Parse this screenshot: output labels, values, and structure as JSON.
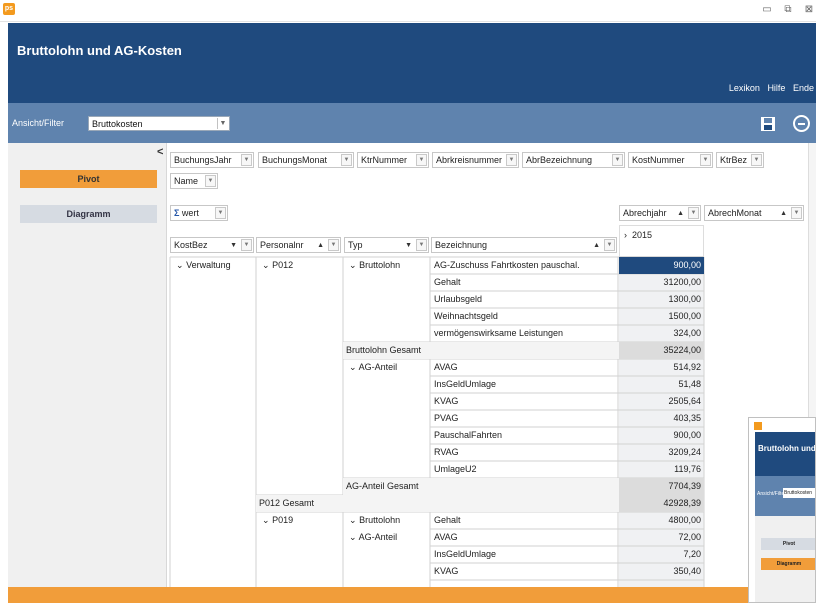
{
  "window": {
    "app_icon": "ps",
    "minimize_glyph": "▭",
    "maximize_glyph": "⧉",
    "close_glyph": "⊠"
  },
  "app": {
    "title": "Bruttolohn und AG-Kosten"
  },
  "top_links": {
    "lexikon": "Lexikon",
    "hilfe": "Hilfe",
    "ende": "Ende"
  },
  "filter": {
    "label": "Ansicht/Filter",
    "value": "Bruttokosten"
  },
  "sidebar": {
    "collapse": "<",
    "pivot": "Pivot",
    "diagramm": "Diagramm"
  },
  "pivot": {
    "filter_fields": [
      "BuchungsJahr",
      "BuchungsMonat",
      "KtrNummer",
      "Abrkreisnummer",
      "AbrBezeichnung",
      "KostNummer",
      "KtrBez",
      "Name"
    ],
    "data_field": {
      "sigma": "Σ",
      "label": "wert"
    },
    "column_fields": [
      "Abrechjahr",
      "AbrechMonat"
    ],
    "row_fields": [
      "KostBez",
      "Personalnr",
      "Typ",
      "Bezeichnung"
    ],
    "column_header": "2015",
    "labels": {
      "kostbez": "Verwaltung",
      "p012": "P012",
      "p019": "P019",
      "bruttolohn": "Bruttolohn",
      "bruttolohn_2": "Bruttolohn",
      "ag_anteil": "AG-Anteil",
      "ag_anteil_2": "AG-Anteil",
      "bruttolohn_total": "Bruttolohn Gesamt",
      "ag_anteil_total": "AG-Anteil Gesamt",
      "p012_total": "P012 Gesamt"
    },
    "rows": [
      {
        "item": "AG-Zuschuss Fahrtkosten pauschal.",
        "value": "900,00"
      },
      {
        "item": "Gehalt",
        "value": "31200,00"
      },
      {
        "item": "Urlaubsgeld",
        "value": "1300,00"
      },
      {
        "item": "Weihnachtsgeld",
        "value": "1500,00"
      },
      {
        "item": "vermögenswirksame Leistungen",
        "value": "324,00"
      },
      {
        "item": "",
        "value": "35224,00"
      },
      {
        "item": "AVAG",
        "value": "514,92"
      },
      {
        "item": "InsGeldUmlage",
        "value": "51,48"
      },
      {
        "item": "KVAG",
        "value": "2505,64"
      },
      {
        "item": "PVAG",
        "value": "403,35"
      },
      {
        "item": "PauschalFahrten",
        "value": "900,00"
      },
      {
        "item": "RVAG",
        "value": "3209,24"
      },
      {
        "item": "UmlageU2",
        "value": "119,76"
      },
      {
        "item": "",
        "value": "7704,39"
      },
      {
        "item": "",
        "value": "42928,39"
      },
      {
        "item": "Gehalt",
        "value": "4800,00"
      },
      {
        "item": "AVAG",
        "value": "72,00"
      },
      {
        "item": "InsGeldUmlage",
        "value": "7,20"
      },
      {
        "item": "KVAG",
        "value": "350,40"
      }
    ]
  },
  "thumbnail": {
    "title": "Bruttolohn und AG-Kosten",
    "filter_label": "Ansicht/Filter",
    "filter_value": "Bruttokosten",
    "pivot": "Pivot",
    "diagramm": "Diagramm"
  },
  "colors": {
    "header": "#1f4a7e",
    "filterbar": "#5f83ae",
    "accent_orange": "#f19d3a",
    "selected_cell": "#1f4a7e"
  }
}
